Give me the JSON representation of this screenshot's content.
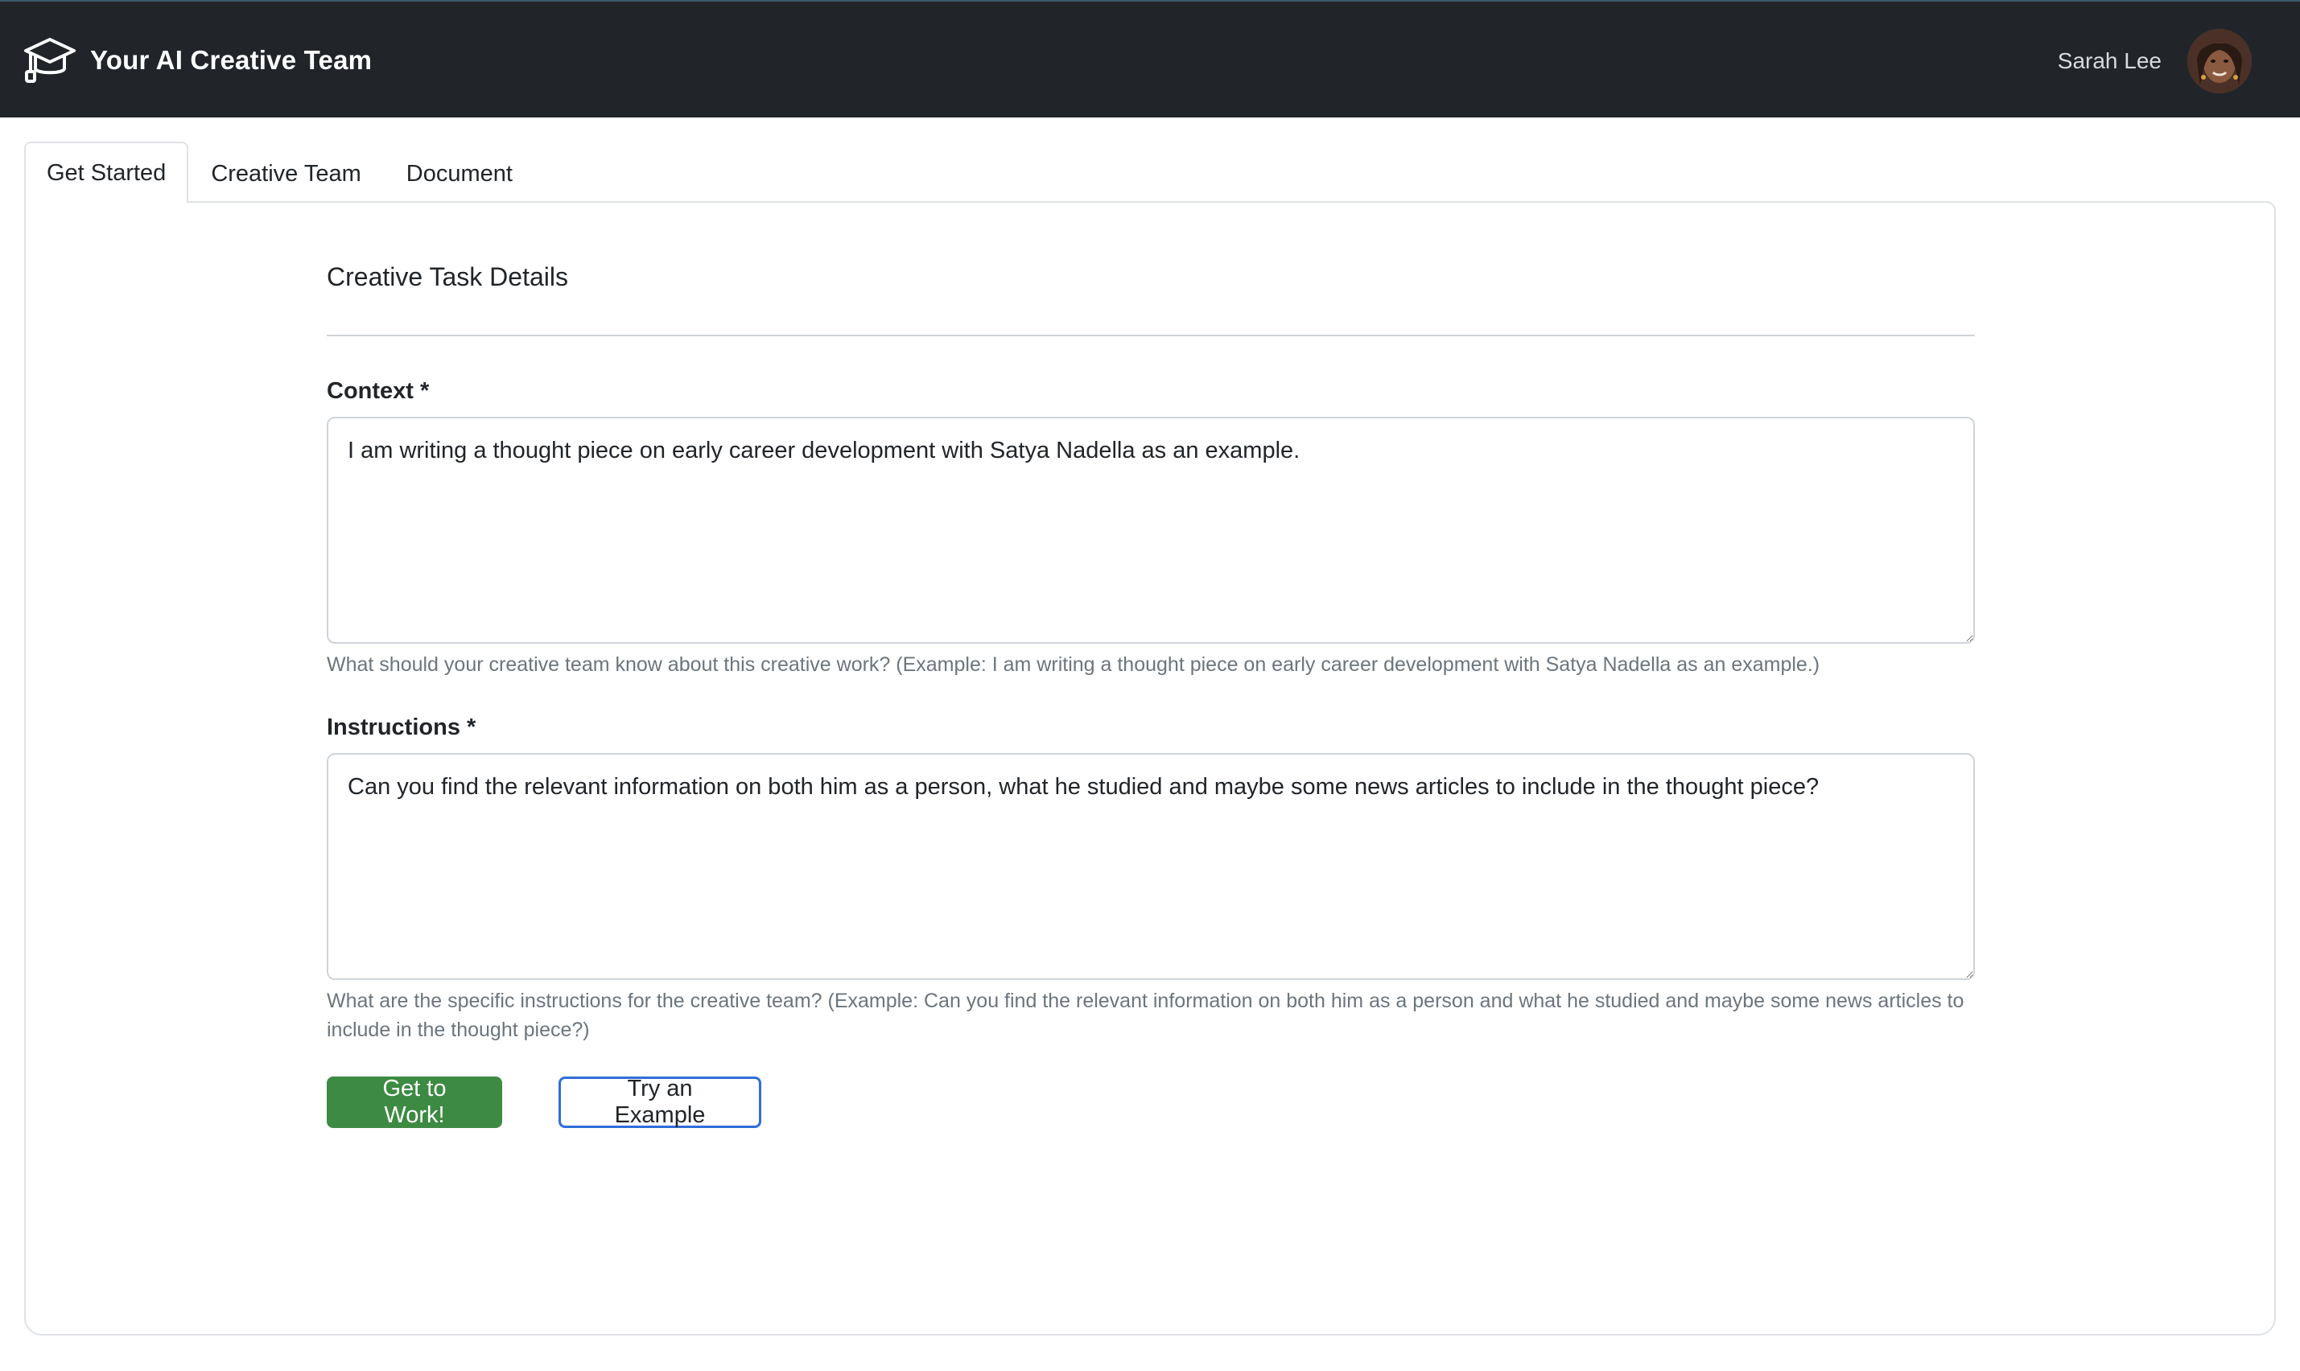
{
  "navbar": {
    "brand_title": "Your AI Creative Team",
    "brand_icon": "graduation-cap-icon",
    "user_name": "Sarah Lee",
    "background_color": "#212529"
  },
  "tabs": [
    {
      "label": "Get Started",
      "active": true
    },
    {
      "label": "Creative Team",
      "active": false
    },
    {
      "label": "Document",
      "active": false
    }
  ],
  "form": {
    "section_title": "Creative Task Details",
    "context": {
      "label": "Context *",
      "value": "I am writing a thought piece on early career development with Satya Nadella as an example.",
      "help": "What should your creative team know about this creative work? (Example: I am writing a thought piece on early career development with Satya Nadella as an example.)"
    },
    "instructions": {
      "label": "Instructions *",
      "value": "Can you find the relevant information on both him as a person, what he studied and maybe some news articles to include in the thought piece?",
      "help": "What are the specific instructions for the creative team? (Example: Can you find the relevant information on both him as a person and what he studied and maybe some news articles to include in the thought piece?)"
    },
    "buttons": {
      "submit_label": "Get to Work!",
      "example_label": "Try an Example"
    }
  },
  "colors": {
    "primary_button": "#3d8a42",
    "outline_button_border": "#2f6ed8"
  }
}
